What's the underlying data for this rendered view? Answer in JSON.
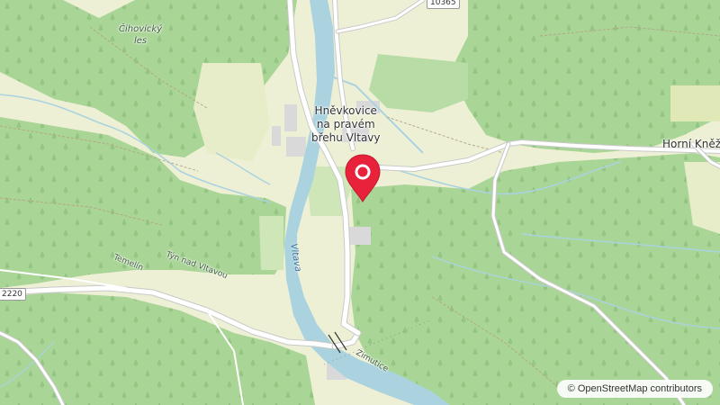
{
  "map": {
    "places": {
      "town": "Hněvkovice\nna pravém\nbřehu Vltavy",
      "east_village": "Horní Kněž",
      "forest": "Čihovický\nles",
      "temelin": "Temelín",
      "tyn": "Týn nad Vltavou",
      "zimutice": "Zimutice"
    },
    "rivers": {
      "vltava": "Vltava"
    },
    "road_refs": {
      "left": "2220",
      "top": "10365"
    },
    "marker": {
      "icon": "map-pin-icon",
      "color": "#e8223a"
    },
    "attribution": "© OpenStreetMap contributors",
    "colors": {
      "forest": "#a9d596",
      "field": "#eef0d5",
      "water": "#aad3df",
      "road": "#ffffff",
      "built": "#d9d9d9"
    }
  }
}
